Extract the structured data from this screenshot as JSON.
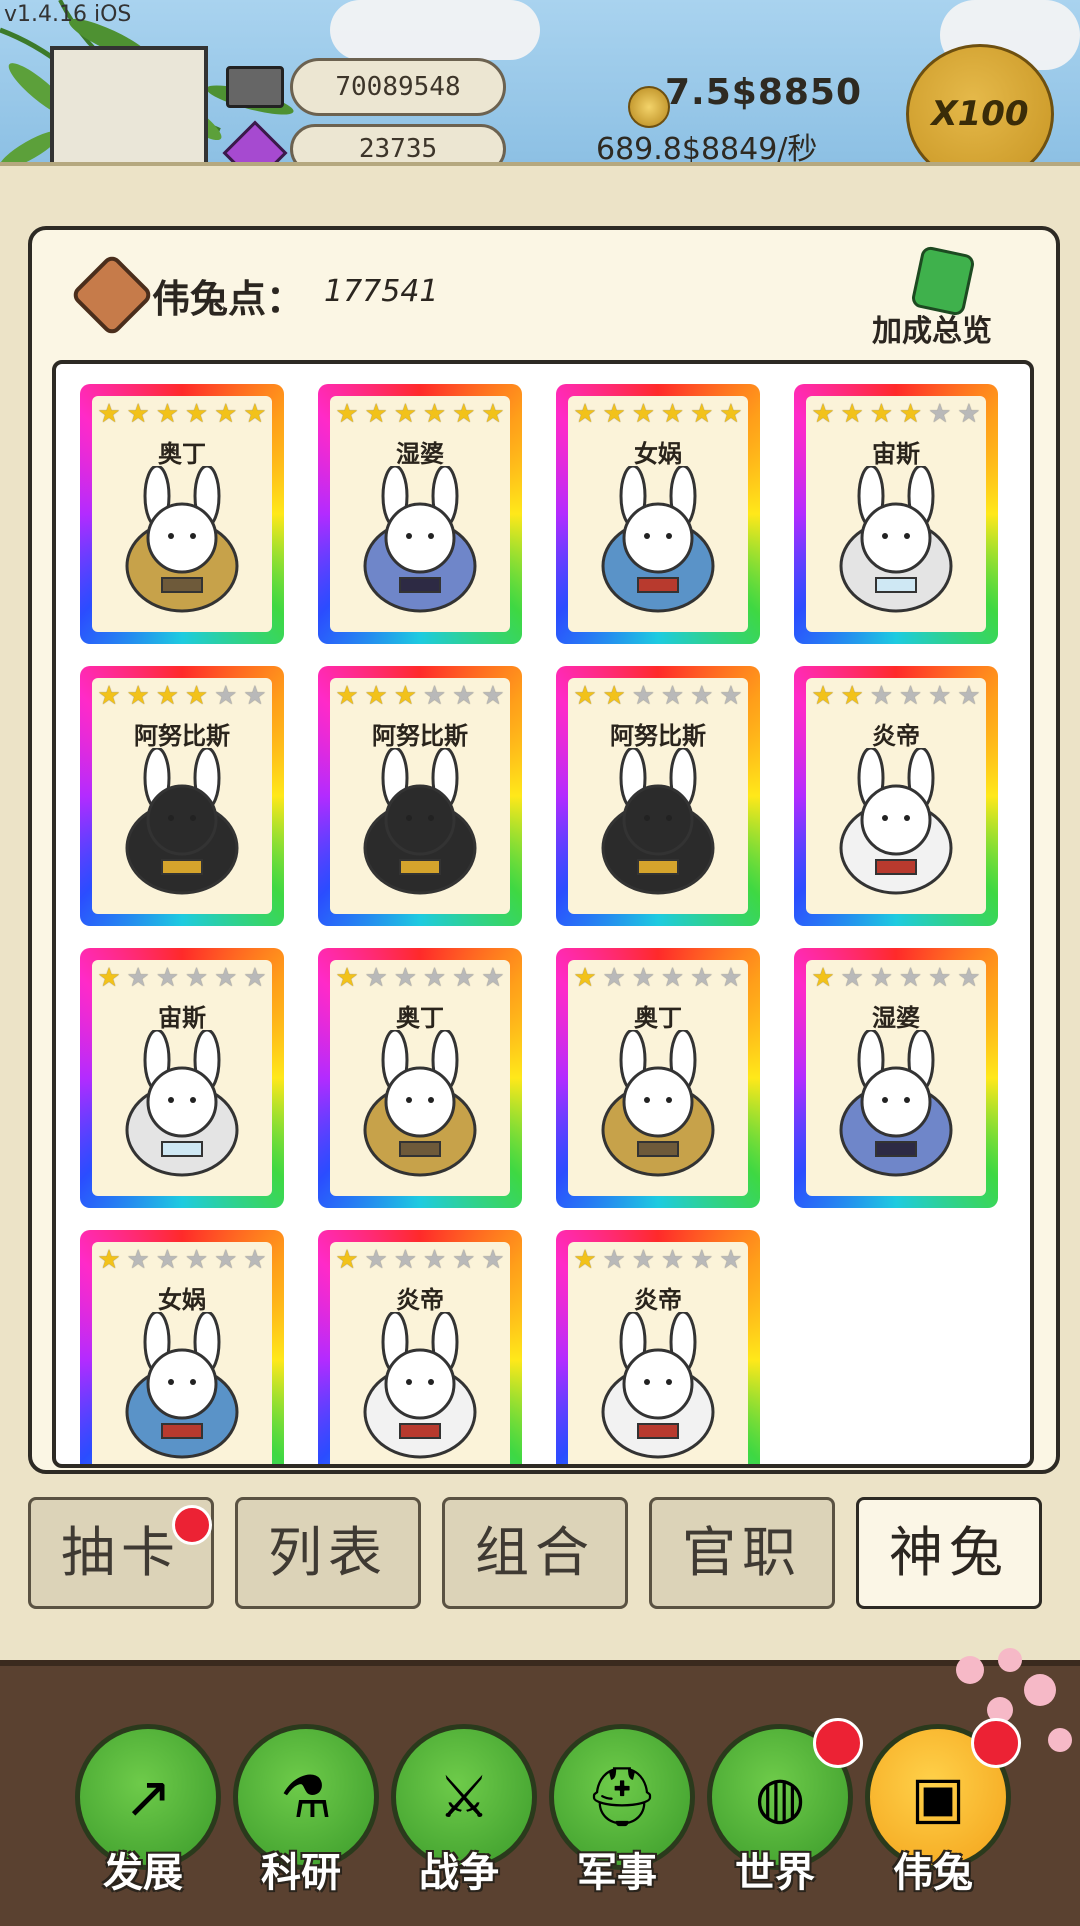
{
  "version": "v1.4.16 iOS",
  "resources": {
    "bricks": "70089548",
    "gems": "23735"
  },
  "money": {
    "total": "7.5$8850",
    "rate": "689.8$8849/秒"
  },
  "multiplier_button": "X100",
  "points": {
    "label": "伟兔点：",
    "value": "177541"
  },
  "bonus_overview_label": "加成总览",
  "cards": [
    {
      "name": "奥丁",
      "stars": 6,
      "max": 6,
      "icon": "odin-rabbit"
    },
    {
      "name": "湿婆",
      "stars": 6,
      "max": 6,
      "icon": "shiva-rabbit"
    },
    {
      "name": "女娲",
      "stars": 6,
      "max": 6,
      "icon": "nuwa-rabbit"
    },
    {
      "name": "宙斯",
      "stars": 4,
      "max": 6,
      "icon": "zeus-rabbit"
    },
    {
      "name": "阿努比斯",
      "stars": 4,
      "max": 6,
      "icon": "anubis-rabbit"
    },
    {
      "name": "阿努比斯",
      "stars": 3,
      "max": 6,
      "icon": "anubis-rabbit"
    },
    {
      "name": "阿努比斯",
      "stars": 2,
      "max": 6,
      "icon": "anubis-rabbit"
    },
    {
      "name": "炎帝",
      "stars": 2,
      "max": 6,
      "icon": "yandi-rabbit"
    },
    {
      "name": "宙斯",
      "stars": 1,
      "max": 6,
      "icon": "zeus-rabbit"
    },
    {
      "name": "奥丁",
      "stars": 1,
      "max": 6,
      "icon": "odin-rabbit"
    },
    {
      "name": "奥丁",
      "stars": 1,
      "max": 6,
      "icon": "odin-rabbit"
    },
    {
      "name": "湿婆",
      "stars": 1,
      "max": 6,
      "icon": "shiva-rabbit"
    },
    {
      "name": "女娲",
      "stars": 1,
      "max": 6,
      "icon": "nuwa-rabbit"
    },
    {
      "name": "炎帝",
      "stars": 1,
      "max": 6,
      "icon": "yandi-rabbit"
    },
    {
      "name": "炎帝",
      "stars": 1,
      "max": 6,
      "icon": "yandi-rabbit"
    }
  ],
  "tabs": [
    {
      "label": "抽卡",
      "badge": true,
      "active": false
    },
    {
      "label": "列表",
      "badge": false,
      "active": false
    },
    {
      "label": "组合",
      "badge": false,
      "active": false
    },
    {
      "label": "官职",
      "badge": false,
      "active": false
    },
    {
      "label": "神兔",
      "badge": false,
      "active": true
    }
  ],
  "bottom_nav": [
    {
      "label": "发展",
      "icon": "arrow-up-icon",
      "badge": false,
      "active": false
    },
    {
      "label": "科研",
      "icon": "flask-icon",
      "badge": false,
      "active": false
    },
    {
      "label": "战争",
      "icon": "crossed-swords-icon",
      "badge": false,
      "active": false
    },
    {
      "label": "军事",
      "icon": "helmet-icon",
      "badge": false,
      "active": false
    },
    {
      "label": "世界",
      "icon": "globe-icon",
      "badge": true,
      "active": false
    },
    {
      "label": "伟兔",
      "icon": "rabbit-portrait-icon",
      "badge": true,
      "active": true
    }
  ]
}
